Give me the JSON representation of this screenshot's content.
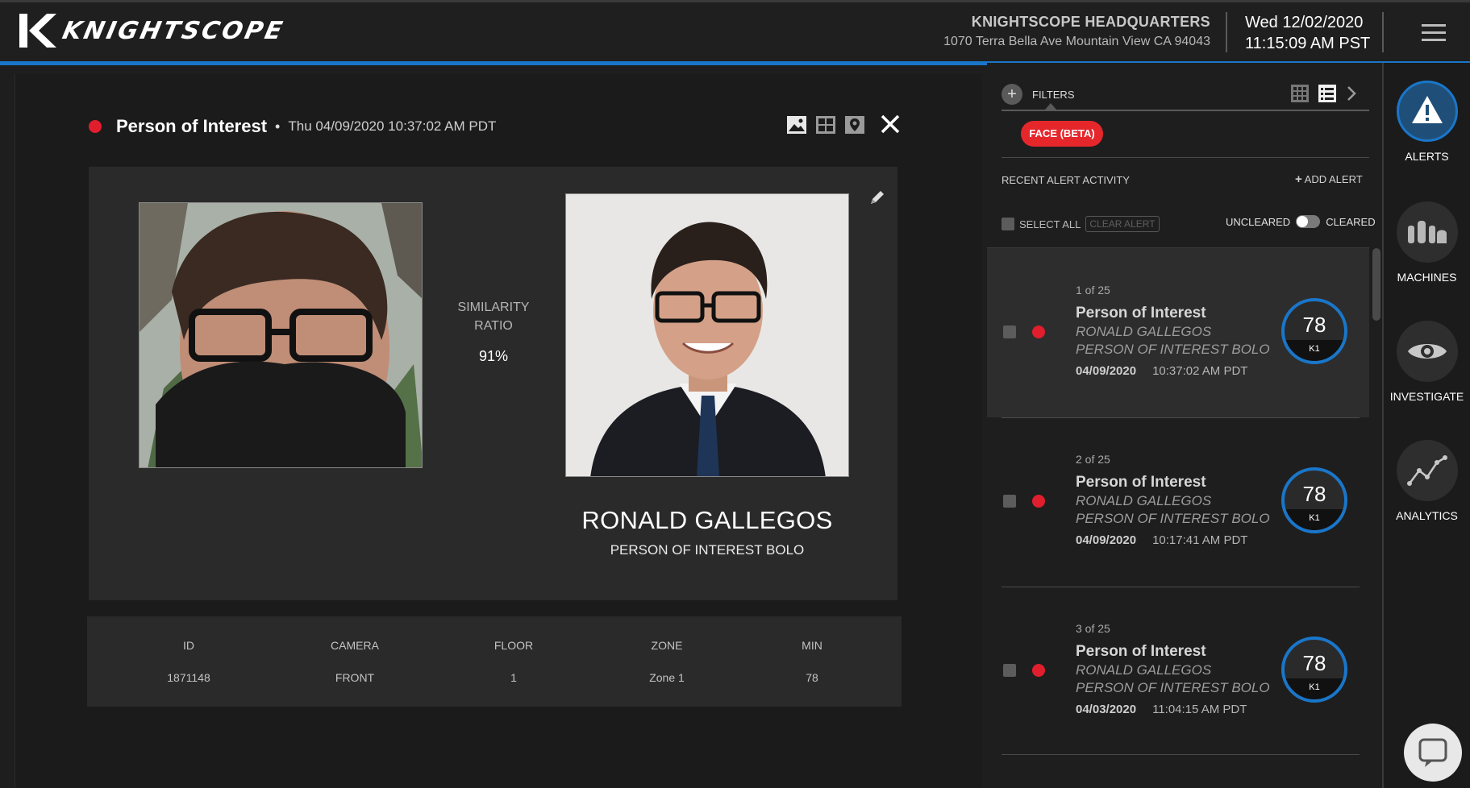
{
  "header": {
    "brand": "KNIGHTSCOPE",
    "site_name": "KNIGHTSCOPE HEADQUARTERS",
    "site_address": "1070 Terra Bella Ave Mountain View CA 94043",
    "date": "Wed 12/02/2020",
    "time": "11:15:09 AM PST"
  },
  "detail": {
    "alert_type": "Person of Interest",
    "separator": "•",
    "timestamp": "Thu 04/09/2020 10:37:02 AM PDT",
    "similarity_label_line1": "SIMILARITY",
    "similarity_label_line2": "RATIO",
    "similarity_value": "91%",
    "match_name": "RONALD GALLEGOS",
    "match_list": "PERSON OF INTEREST BOLO",
    "table": {
      "headers": [
        "ID",
        "CAMERA",
        "FLOOR",
        "ZONE",
        "MIN"
      ],
      "values": [
        "1871148",
        "FRONT",
        "1",
        "Zone 1",
        "78"
      ]
    }
  },
  "alerts_panel": {
    "filters_label": "FILTERS",
    "filter_chip": "FACE (BETA)",
    "recent_label": "RECENT ALERT ACTIVITY",
    "add_alert_label": "ADD ALERT",
    "select_all_label": "SELECT ALL",
    "clear_alert_label": "CLEAR ALERT",
    "uncleared_label": "UNCLEARED",
    "cleared_label": "CLEARED",
    "items": [
      {
        "count": "1 of 25",
        "title": "Person of Interest",
        "name": "RONALD GALLEGOS",
        "list": "PERSON OF INTEREST BOLO",
        "date": "04/09/2020",
        "time": "10:37:02 AM PDT",
        "score": "78",
        "score_tag": "K1"
      },
      {
        "count": "2 of 25",
        "title": "Person of Interest",
        "name": "RONALD GALLEGOS",
        "list": "PERSON OF INTEREST BOLO",
        "date": "04/09/2020",
        "time": "10:17:41 AM PDT",
        "score": "78",
        "score_tag": "K1"
      },
      {
        "count": "3 of 25",
        "title": "Person of Interest",
        "name": "RONALD GALLEGOS",
        "list": "PERSON OF INTEREST BOLO",
        "date": "04/03/2020",
        "time": "11:04:15 AM PDT",
        "score": "78",
        "score_tag": "K1"
      }
    ]
  },
  "nav": {
    "alerts": "ALERTS",
    "machines": "MACHINES",
    "investigate": "INVESTIGATE",
    "analytics": "ANALYTICS"
  },
  "colors": {
    "accent_blue": "#1a76c9",
    "alert_red": "#e01e2d",
    "chip_red": "#e5272c"
  }
}
